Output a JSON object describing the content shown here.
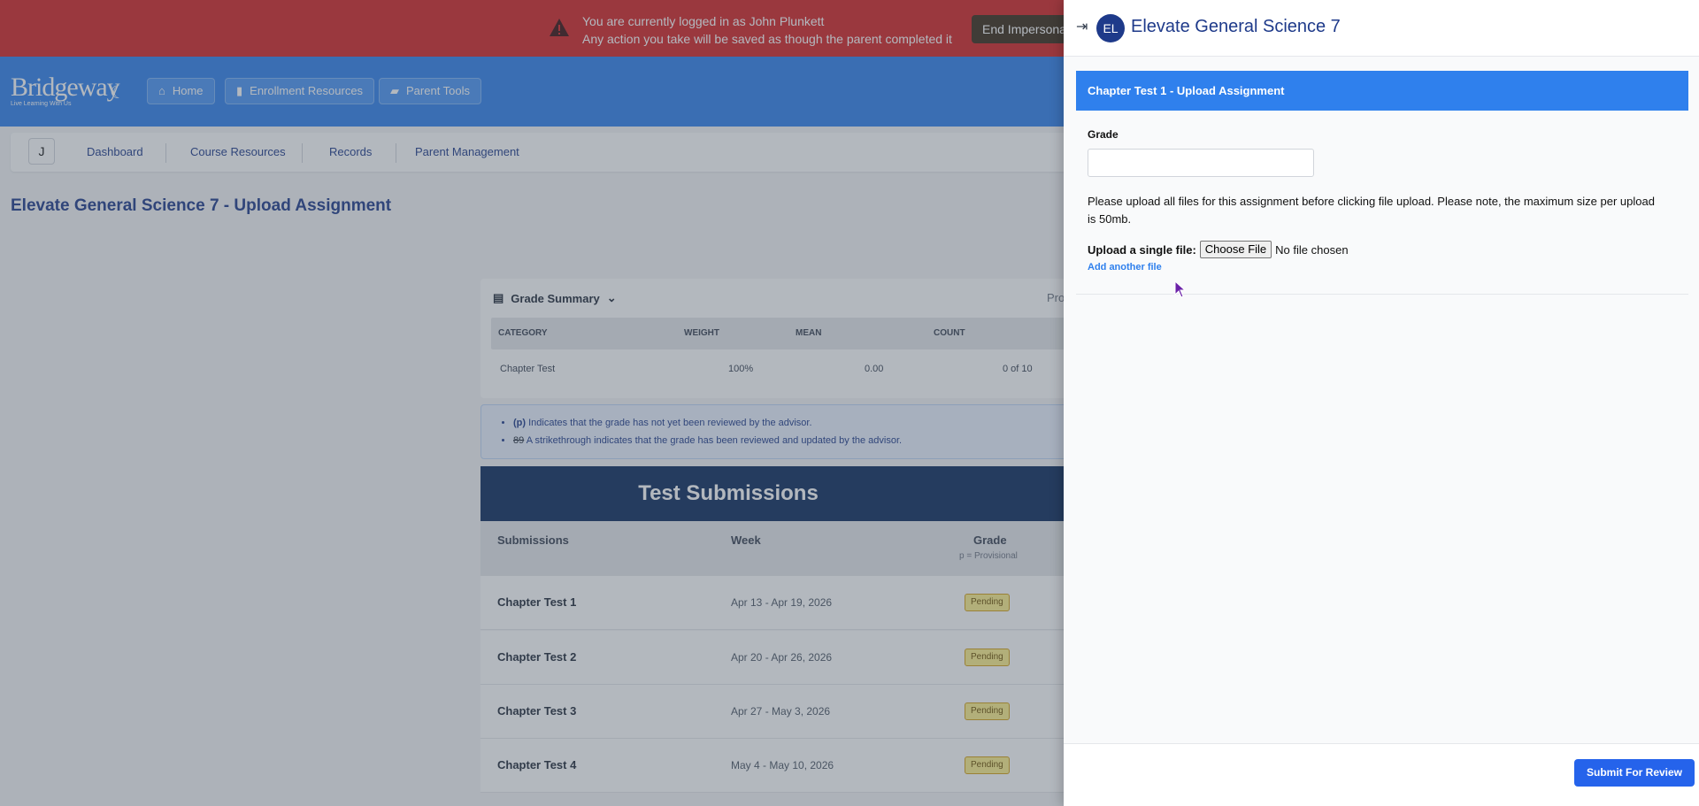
{
  "impersonation": {
    "line1": "You are currently logged in as John Plunkett",
    "line2": "Any action you take will be saved as though the parent completed it",
    "end_button": "End Impersonation"
  },
  "colors": {
    "alert": "#d42323",
    "brand": "#2f80ed",
    "navy": "#1e3a8a",
    "pending": "#fef08a"
  },
  "topnav": {
    "logo_name": "Bridgeway",
    "logo_tagline": "Live Learning With Us",
    "buttons": [
      {
        "label": "Home",
        "icon": "home-icon"
      },
      {
        "label": "Enrollment Resources",
        "icon": "bar-chart-icon"
      },
      {
        "label": "Parent Tools",
        "icon": "folder-icon"
      }
    ]
  },
  "subnav": {
    "avatar_letter": "J",
    "items": [
      "Dashboard",
      "Course Resources",
      "Records",
      "Parent Management"
    ]
  },
  "page": {
    "title": "Elevate General Science 7 - Upload Assignment"
  },
  "grade_summary": {
    "title": "Grade Summary",
    "truncated_right": "Pro",
    "headers": [
      "CATEGORY",
      "WEIGHT",
      "MEAN",
      "COUNT"
    ],
    "rows": [
      {
        "category": "Chapter Test",
        "weight": "100%",
        "mean": "0.00",
        "count": "0 of 10"
      }
    ]
  },
  "legend": {
    "item1_mark": "(p)",
    "item1_text": " Indicates that the grade has not yet been reviewed by the advisor.",
    "item2_mark": "89",
    "item2_text": " A strikethrough indicates that the grade has been reviewed and updated by the advisor."
  },
  "submissions": {
    "title": "Test Submissions",
    "col_submissions": "Submissions",
    "col_week": "Week",
    "col_grade": "Grade",
    "col_grade_sub": "p = Provisional",
    "rows": [
      {
        "name": "Chapter Test 1",
        "week": "Apr 13 - Apr 19, 2026",
        "status": "Pending"
      },
      {
        "name": "Chapter Test 2",
        "week": "Apr 20 - Apr 26, 2026",
        "status": "Pending"
      },
      {
        "name": "Chapter Test 3",
        "week": "Apr 27 - May 3, 2026",
        "status": "Pending"
      },
      {
        "name": "Chapter Test 4",
        "week": "May 4 - May 10, 2026",
        "status": "Pending"
      }
    ]
  },
  "drawer": {
    "avatar": "EL",
    "title": "Elevate General Science 7",
    "card_title": "Chapter Test 1 - Upload Assignment",
    "grade_label": "Grade",
    "grade_value": "",
    "instructions": "Please upload all files for this assignment before clicking file upload. Please note, the maximum size per upload is 50mb.",
    "upload_label": "Upload a single file:",
    "choose_file": "Choose File",
    "no_file": "No file chosen",
    "add_another": "Add another file",
    "submit": "Submit For Review"
  }
}
